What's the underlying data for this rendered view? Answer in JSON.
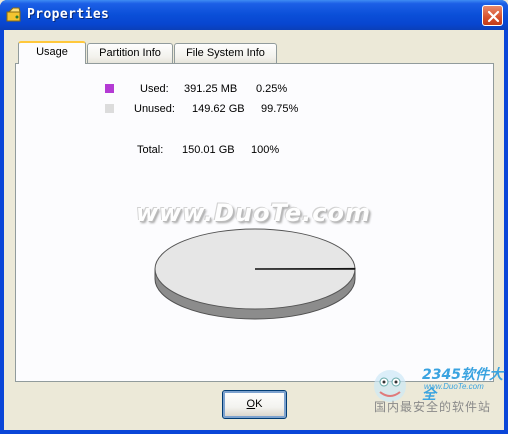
{
  "window": {
    "title": "Properties"
  },
  "tabs": [
    {
      "label": "Usage",
      "active": true
    },
    {
      "label": "Partition Info",
      "active": false
    },
    {
      "label": "File System Info",
      "active": false
    }
  ],
  "usage": {
    "used": {
      "label": "Used:",
      "size": "391.25 MB",
      "percent": "0.25%",
      "color": "#b43ad4"
    },
    "unused": {
      "label": "Unused:",
      "size": "149.62 GB",
      "percent": "99.75%",
      "color": "#dcdcdc"
    },
    "total": {
      "label": "Total:",
      "size": "150.01 GB",
      "percent": "100%"
    }
  },
  "chart_data": {
    "type": "pie",
    "categories": [
      "Used",
      "Unused"
    ],
    "values": [
      0.25,
      99.75
    ],
    "colors": [
      "#b43ad4",
      "#dcdcdc"
    ]
  },
  "watermark": {
    "text": "www.DuoTe.com"
  },
  "buttons": {
    "ok_label": "OK"
  },
  "branding": {
    "brand": "2345软件大全",
    "url": "www.DuoTe.com",
    "slogan": "国内最安全的软件站"
  }
}
